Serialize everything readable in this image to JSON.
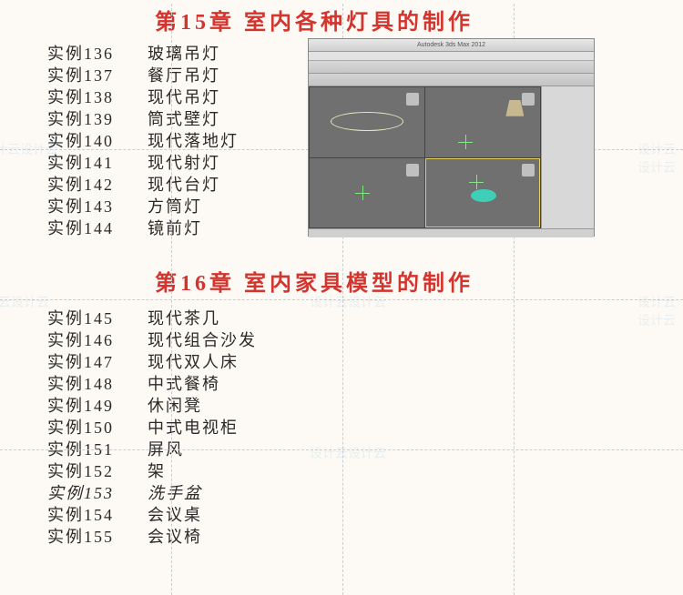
{
  "watermark": "设计云设计云",
  "chapters": [
    {
      "heading": "第15章  室内各种灯具的制作",
      "items": [
        {
          "num": "实例136",
          "title": "玻璃吊灯"
        },
        {
          "num": "实例137",
          "title": "餐厅吊灯"
        },
        {
          "num": "实例138",
          "title": "现代吊灯"
        },
        {
          "num": "实例139",
          "title": "筒式壁灯"
        },
        {
          "num": "实例140",
          "title": "现代落地灯"
        },
        {
          "num": "实例141",
          "title": "现代射灯"
        },
        {
          "num": "实例142",
          "title": "现代台灯"
        },
        {
          "num": "实例143",
          "title": "方筒灯"
        },
        {
          "num": "实例144",
          "title": "镜前灯"
        }
      ]
    },
    {
      "heading": "第16章  室内家具模型的制作",
      "items": [
        {
          "num": "实例145",
          "title": "现代茶几"
        },
        {
          "num": "实例146",
          "title": "现代组合沙发"
        },
        {
          "num": "实例147",
          "title": "现代双人床"
        },
        {
          "num": "实例148",
          "title": "中式餐椅"
        },
        {
          "num": "实例149",
          "title": "休闲凳"
        },
        {
          "num": "实例150",
          "title": "中式电视柜"
        },
        {
          "num": "实例151",
          "title": "屏风"
        },
        {
          "num": "实例152",
          "title": "架"
        },
        {
          "num": "实例153",
          "title": "洗手盆"
        },
        {
          "num": "实例154",
          "title": "会议桌"
        },
        {
          "num": "实例155",
          "title": "会议椅"
        }
      ]
    }
  ],
  "screenshot": {
    "title": "Autodesk 3ds Max  2012"
  }
}
